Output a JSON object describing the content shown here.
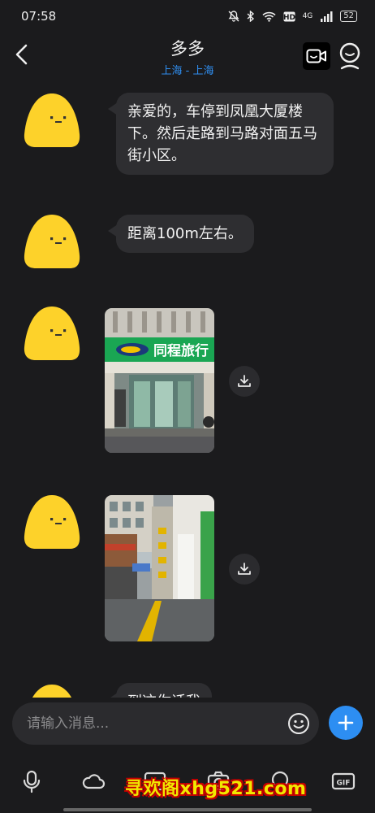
{
  "status_bar": {
    "time": "07:58",
    "network": "4G",
    "battery": "52"
  },
  "header": {
    "title": "多多",
    "subtitle": "上海 - 上海"
  },
  "messages": [
    {
      "type": "text",
      "text": "亲爱的，车停到凤凰大厦楼下。然后走路到马路对面五马街小区。"
    },
    {
      "type": "text",
      "text": "距离100m左右。"
    },
    {
      "type": "image",
      "sign_text": "同程旅行"
    },
    {
      "type": "image",
      "sign_text": ""
    },
    {
      "type": "text",
      "text": "到这你话我"
    }
  ],
  "composer": {
    "placeholder": "请输入消息..."
  },
  "toolbar": {
    "items": [
      "microphone-icon",
      "cloud-icon",
      "image-icon",
      "camera-icon",
      "search-icon",
      "gif-icon"
    ]
  },
  "watermark": {
    "text": "寻欢阁xhg521.com"
  },
  "colors": {
    "background": "#1b1b1d",
    "bubble": "#2e2e31",
    "accent": "#2d8ef2",
    "avatar": "#fdd22a"
  }
}
